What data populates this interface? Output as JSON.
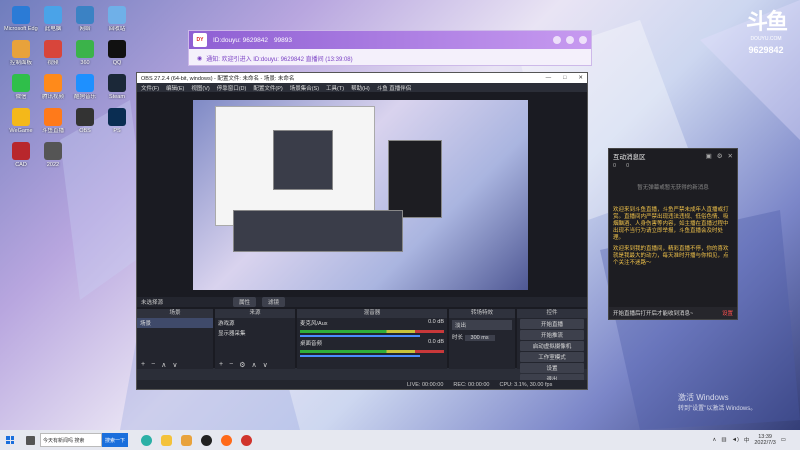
{
  "desktop": {
    "icons": [
      {
        "label": "Microsoft Edge",
        "color": "#2b7bd6"
      },
      {
        "label": "此电脑",
        "color": "#4aa3e8"
      },
      {
        "label": "网络",
        "color": "#3b82c4"
      },
      {
        "label": "回收站",
        "color": "#6fb0e8"
      },
      {
        "label": "控制面板",
        "color": "#e8a23b"
      },
      {
        "label": "视频",
        "color": "#d8453b"
      },
      {
        "label": "360",
        "color": "#3bb34a"
      },
      {
        "label": "QQ",
        "color": "#111"
      },
      {
        "label": "微信",
        "color": "#2fbf4a"
      },
      {
        "label": "腾讯视频",
        "color": "#ff8a1a"
      },
      {
        "label": "酷狗音乐",
        "color": "#1e90ff"
      },
      {
        "label": "Steam",
        "color": "#1b2838"
      },
      {
        "label": "WeGame",
        "color": "#f4b81a"
      },
      {
        "label": "斗鱼直播",
        "color": "#ff7a1a"
      },
      {
        "label": "OBS",
        "color": "#333"
      },
      {
        "label": "PS",
        "color": "#0a2d52"
      },
      {
        "label": "CAD",
        "color": "#b8272c"
      },
      {
        "label": "2022",
        "color": "#555"
      }
    ]
  },
  "douyu_logo": {
    "brand": "斗鱼",
    "site": "DOUYU.COM",
    "room": "9629842"
  },
  "douyu_bar": {
    "title": "ID:douyu: 9629842",
    "fans": "99893",
    "notice": "通知: 欢迎引进入 ID:douyu: 9629842 直播间 (13:39:08)"
  },
  "obs": {
    "title": "OBS 27.2.4 (64-bit, windows) - 配置文件: 未命名 - 场景: 未命名",
    "menu": [
      "文件(F)",
      "编辑(E)",
      "视图(V)",
      "停靠窗口(D)",
      "配置文件(P)",
      "场景集合(S)",
      "工具(T)",
      "帮助(H)",
      "斗鱼 直播伴侣"
    ],
    "win_controls": [
      "—",
      "□",
      "✕"
    ],
    "tabbar_left": "未选择源",
    "tab_btn1": "属性",
    "tab_btn2": "滤镜",
    "docks": {
      "scenes": {
        "header": "场景",
        "items": [
          "场景"
        ]
      },
      "sources": {
        "header": "来源",
        "items": [
          "游戏源",
          "显示器采集"
        ]
      },
      "mixer": {
        "header": "混音器",
        "rows": [
          {
            "name": "麦克风/Aux",
            "db": "0.0 dB"
          },
          {
            "name": "桌面音频",
            "db": "0.0 dB"
          }
        ]
      },
      "transitions": {
        "header": "转场特效",
        "type": "淡出",
        "duration_label": "时长",
        "duration": "300 ms"
      },
      "controls": {
        "header": "控件",
        "buttons": [
          "开始直播",
          "开始推流",
          "启动虚拟摄像机",
          "工作室模式",
          "设置",
          "退出"
        ]
      }
    },
    "status": {
      "live": "LIVE: 00:00:00",
      "rec": "REC: 00:00:00",
      "cpu": "CPU: 3.1%, 30.00 fps"
    }
  },
  "chat": {
    "title": "互动消息区",
    "stats1": "0",
    "stats2": "0",
    "empty": "暂无弹幕或暂无获得的新消息",
    "welcome": "欢迎来到斗鱼直播，斗鱼严禁未成年人直播或打赏。直播间内严禁出现违法违规、低俗色情、吸烟酗酒、人身伤害等内容，如主播在直播过程中出现不当行为请立即举报，斗鱼直播会及时处理。",
    "tip": "欢迎来到我的直播间，精彩直播不停，你的喜欢就是我最大的动力，每天准时开播与你相见，点个关注不迷路～",
    "footer_left": "开始直播后打开后才能收到消息~",
    "footer_right": "设置"
  },
  "activate": {
    "line1": "激活 Windows",
    "line2": "转到\"设置\"以激活 Windows。"
  },
  "taskbar": {
    "search": "今天有新闻吗  搜索",
    "search_btn": "搜索一下",
    "time": "13:39",
    "date": "2022/7/3",
    "lang": "中"
  }
}
